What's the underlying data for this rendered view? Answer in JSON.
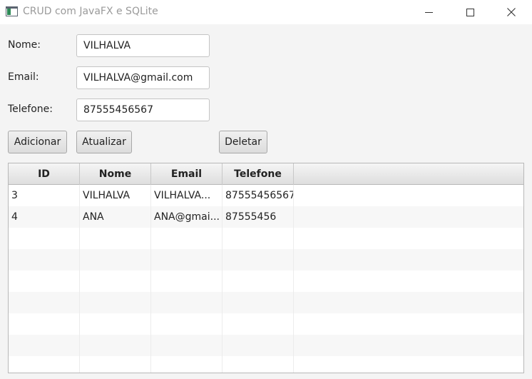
{
  "window": {
    "title": "CRUD com JavaFX e SQLite"
  },
  "form": {
    "nome_label": "Nome:",
    "nome_value": "VILHALVA",
    "email_label": "Email:",
    "email_value": "VILHALVA@gmail.com",
    "telefone_label": "Telefone:",
    "telefone_value": "87555456567"
  },
  "buttons": {
    "add": "Adicionar",
    "update": "Atualizar",
    "delete": "Deletar"
  },
  "table": {
    "columns": [
      "ID",
      "Nome",
      "Email",
      "Telefone"
    ],
    "rows": [
      {
        "id": "3",
        "nome": "VILHALVA",
        "email": "VILHALVA...",
        "telefone": "87555456567"
      },
      {
        "id": "4",
        "nome": "ANA",
        "email": "ANA@gmai...",
        "telefone": "87555456"
      }
    ]
  }
}
